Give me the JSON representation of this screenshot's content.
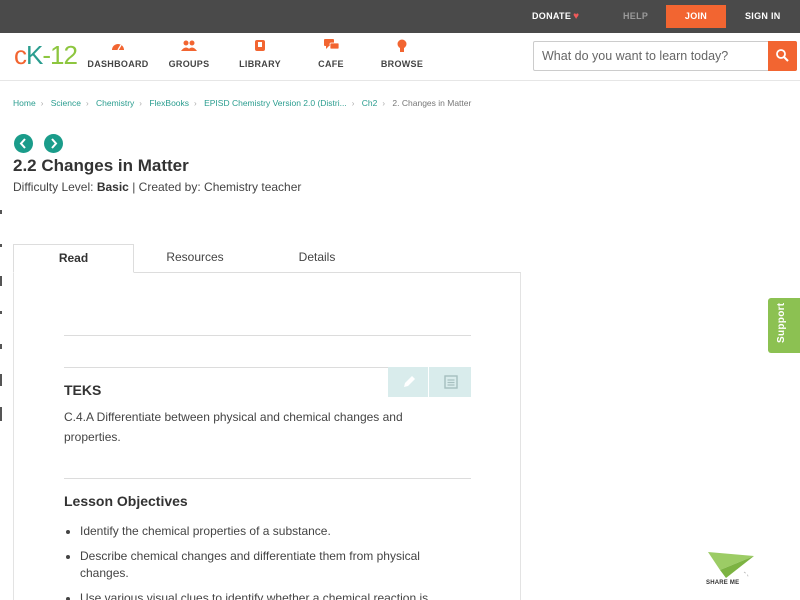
{
  "topbar": {
    "donate": "DONATE",
    "help": "HELP",
    "join": "JOIN",
    "sign_in": "SIGN IN"
  },
  "logo": {
    "c": "c",
    "k": "K",
    "dash": "-",
    "num": "12"
  },
  "nav": [
    {
      "label": "DASHBOARD",
      "icon": "dashboard-gauge-icon"
    },
    {
      "label": "GROUPS",
      "icon": "groups-people-icon"
    },
    {
      "label": "LIBRARY",
      "icon": "library-book-icon"
    },
    {
      "label": "CAFE",
      "icon": "cafe-chat-icon"
    },
    {
      "label": "BROWSE",
      "icon": "browse-bulb-icon"
    }
  ],
  "search": {
    "placeholder": "What do you want to learn today?",
    "value": ""
  },
  "breadcrumb": [
    "Home",
    "Science",
    "Chemistry",
    "FlexBooks",
    "EPISD Chemistry Version 2.0 (Distri...",
    "Ch2",
    "2. Changes in Matter"
  ],
  "page": {
    "title": "2.2 Changes in Matter",
    "difficulty_label": "Difficulty Level:",
    "difficulty_value": "Basic",
    "created_by": "| Created by: Chemistry teacher"
  },
  "tabs": [
    "Read",
    "Resources",
    "Details"
  ],
  "teks": {
    "heading": "TEKS",
    "text": "C.4.A Differentiate between physical and chemical changes and properties."
  },
  "objectives": {
    "heading": "Lesson Objectives",
    "items": [
      "Identify the chemical properties of a substance.",
      "Describe chemical changes and differentiate them from physical changes.",
      "Use various visual clues to identify whether a chemical reaction is"
    ]
  },
  "support_label": "Support",
  "share_label": "SHARE ME",
  "colors": {
    "accent": "#f26531",
    "teal": "#2a9d8f",
    "green": "#8cc152",
    "topbar": "#4a4a4a"
  }
}
